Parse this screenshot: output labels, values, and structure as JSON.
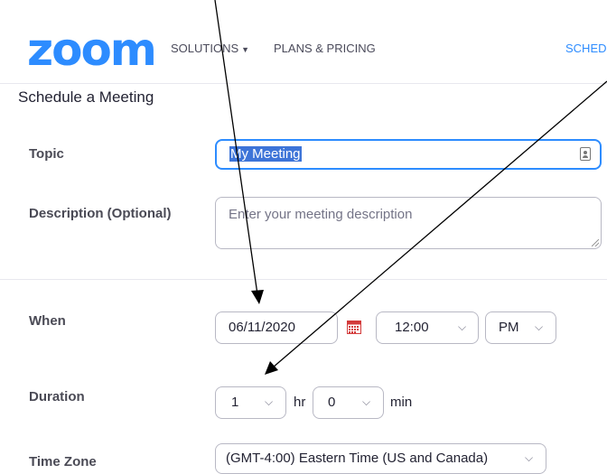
{
  "header": {
    "logo": "zoom",
    "nav": [
      {
        "label": "SOLUTIONS",
        "has_dropdown": true
      },
      {
        "label": "PLANS & PRICING"
      }
    ],
    "schedule_link": "SCHED"
  },
  "page_title": "Schedule a Meeting",
  "form": {
    "topic": {
      "label": "Topic",
      "value": "My Meeting",
      "selected": true
    },
    "description": {
      "label": "Description (Optional)",
      "placeholder": "Enter your meeting description"
    },
    "when": {
      "label": "When",
      "date": "06/11/2020",
      "time": "12:00",
      "ampm": "PM"
    },
    "duration": {
      "label": "Duration",
      "hours": "1",
      "hours_unit": "hr",
      "minutes": "0",
      "minutes_unit": "min"
    },
    "time_zone": {
      "label": "Time Zone",
      "value": "(GMT-4:00) Eastern Time (US and Canada)"
    }
  },
  "colors": {
    "brand": "#2D8CFF",
    "selection": "#3d74d8",
    "calendar_icon": "#d33b3b"
  },
  "icons": [
    "chevron-down-icon",
    "calendar-icon",
    "contact-card-icon",
    "resize-grip-icon"
  ]
}
